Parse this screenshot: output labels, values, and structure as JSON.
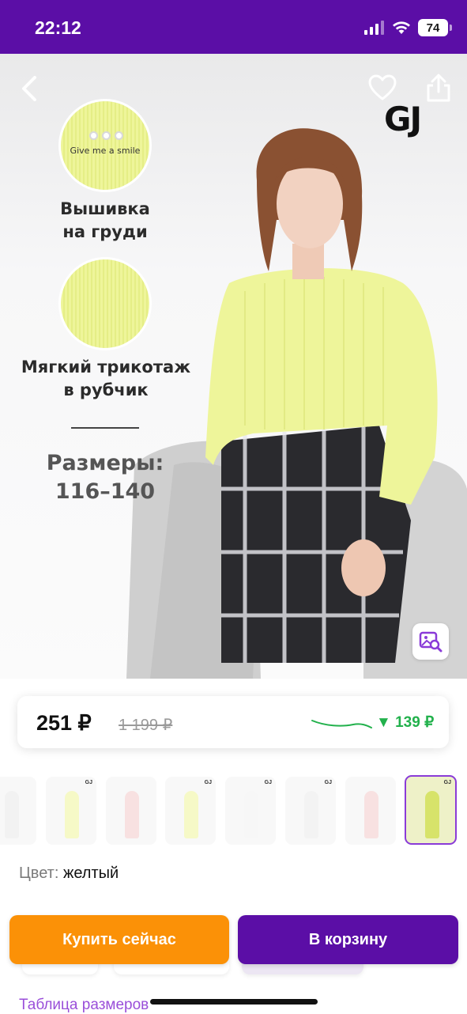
{
  "status_bar": {
    "time": "22:12",
    "battery": "74",
    "icons": [
      "signal-icon",
      "wifi-icon",
      "battery-icon"
    ],
    "background": "#5b0ea6"
  },
  "product_image": {
    "brand": "GJ",
    "feature_1": {
      "circle_text": "Give me a smile",
      "label_line1": "Вышивка",
      "label_line2": "на груди"
    },
    "feature_2": {
      "label_line1": "Мягкий трикотаж",
      "label_line2": "в рубчик"
    },
    "sizes_title": "Размеры:",
    "sizes_range": "116–140",
    "sweater_text": "Give me a smile",
    "sweater_color": "#eef59a",
    "icons": [
      "back-icon",
      "heart-icon",
      "share-icon",
      "visual-search-icon"
    ]
  },
  "price": {
    "current": "251 ₽",
    "old": "1 199 ₽",
    "difference": "▼ 139 ₽",
    "difference_color": "#22b14c"
  },
  "thumbnails": {
    "count": 8,
    "selected_index": 7,
    "brand": "GJ"
  },
  "color": {
    "label": "Цвет:",
    "value": "желтый"
  },
  "actions": {
    "buy_now": "Купить сейчас",
    "add_to_cart": "В корзину",
    "buy_color": "#fb9107",
    "cart_color": "#5b0ea6"
  },
  "size_table_link": "Таблица размеров"
}
